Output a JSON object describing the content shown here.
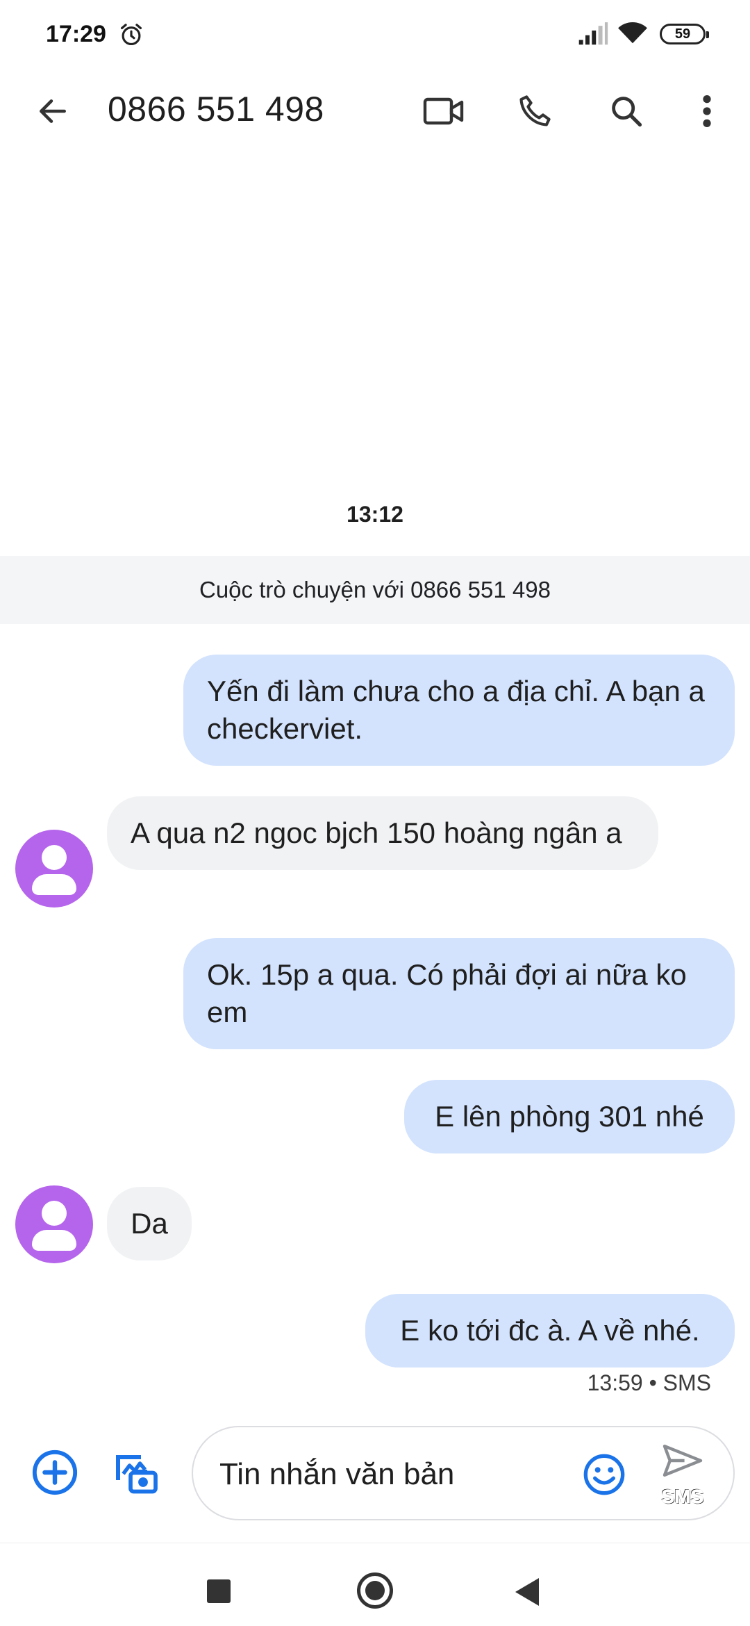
{
  "status_bar": {
    "time": "17:29",
    "battery": "59",
    "icons": [
      "alarm-icon",
      "signal-icon",
      "wifi-icon",
      "battery-icon"
    ]
  },
  "app_bar": {
    "title": "0866 551 498",
    "actions": [
      "back-arrow-icon",
      "video-call-icon",
      "phone-icon",
      "search-icon",
      "more-vert-icon"
    ]
  },
  "conversation": {
    "date_stamp": "13:12",
    "banner": "Cuộc trò chuyện với 0866 551 498",
    "messages": [
      {
        "direction": "outgoing",
        "text": "Yến đi làm chưa cho a địa chỉ. A bạn a checkerviet."
      },
      {
        "direction": "incoming",
        "text": "A qua n2 ngoc bjch 150 hoàng ngân a"
      },
      {
        "direction": "outgoing",
        "text": "Ok. 15p a qua. Có phải đợi ai nữa ko em"
      },
      {
        "direction": "outgoing",
        "text": "E lên phòng 301 nhé"
      },
      {
        "direction": "incoming",
        "text": "Da"
      },
      {
        "direction": "outgoing",
        "text": "E ko tới đc à. A về nhé."
      }
    ],
    "last_meta": "13:59 • SMS"
  },
  "compose": {
    "placeholder": "Tin nhắn văn bản",
    "send_label": "SMS",
    "icons": [
      "add-circle-icon",
      "gallery-icon",
      "emoji-icon",
      "send-icon"
    ]
  },
  "colors": {
    "outgoing_bubble": "#d3e3fd",
    "incoming_bubble": "#f1f2f4",
    "avatar": "#b565ec",
    "accent": "#1a73e8"
  }
}
